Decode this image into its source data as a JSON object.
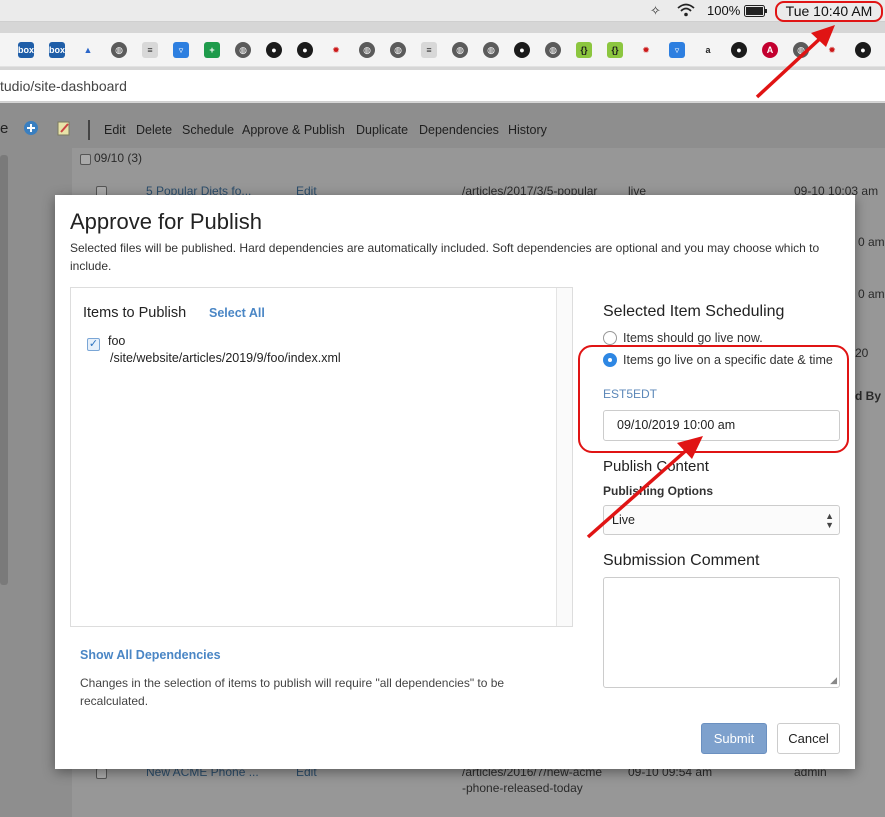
{
  "menubar": {
    "battery": "100%",
    "clock": "Tue 10:40 AM"
  },
  "browser": {
    "url": "tudio/site-dashboard",
    "bookmark_icons": [
      "box-icon",
      "box-icon",
      "atlassian-icon",
      "globe-icon",
      "docs-icon",
      "bitbucket-icon",
      "sheets-icon",
      "globe-icon",
      "github-icon",
      "github-icon",
      "crafter-icon",
      "globe-icon",
      "globe-icon",
      "docs-icon",
      "globe-icon",
      "globe-icon",
      "github-icon",
      "globe-icon",
      "code-icon",
      "code-icon",
      "crafter-icon",
      "bitbucket-icon",
      "amazon-icon",
      "github-icon",
      "angular-icon",
      "globe-icon",
      "crafter-icon",
      "github-icon"
    ]
  },
  "app_toolbar": {
    "items": [
      "Edit",
      "Delete",
      "Schedule",
      "Approve & Publish",
      "Duplicate",
      "Dependencies",
      "History"
    ]
  },
  "background": {
    "group_label": "09/10 (3)",
    "row1": {
      "title": "5 Popular Diets fo...",
      "action": "Edit",
      "path": "/articles/2017/3/5-popular",
      "env": "live",
      "date": "09-10 10:03 am"
    },
    "partial_times": [
      "0 am",
      "0 am"
    ],
    "partial_num": "20",
    "partial_header": "d By",
    "row_last": {
      "title": "New ACME Phone ...",
      "action": "Edit",
      "path": "/articles/2016/7/new-acme",
      "path2": "-phone-released-today",
      "date": "09-10 09:54 am",
      "user": "admin"
    }
  },
  "modal": {
    "title": "Approve for Publish",
    "description": "Selected files will be published. Hard dependencies are automatically included. Soft dependencies are optional and you may choose which to include.",
    "items_heading": "Items to Publish",
    "select_all": "Select All",
    "items": [
      {
        "name": "foo",
        "path": "/site/website/articles/2019/9/foo/index.xml",
        "checked": true
      }
    ],
    "show_dependencies": "Show All Dependencies",
    "dependencies_note": "Changes in the selection of items to publish will require \"all dependencies\" to be recalculated.",
    "scheduling": {
      "heading": "Selected Item Scheduling",
      "option_now": "Items should go live now.",
      "option_date": "Items go live on a specific date & time",
      "selected": "option_date",
      "timezone": "EST5EDT",
      "datetime_value": "09/10/2019 10:00 am"
    },
    "publish_content": {
      "heading": "Publish Content",
      "options_label": "Publishing Options",
      "selected_option": "Live"
    },
    "comment": {
      "heading": "Submission Comment",
      "value": ""
    },
    "submit_label": "Submit",
    "cancel_label": "Cancel"
  },
  "annotation_color": "#e01414"
}
